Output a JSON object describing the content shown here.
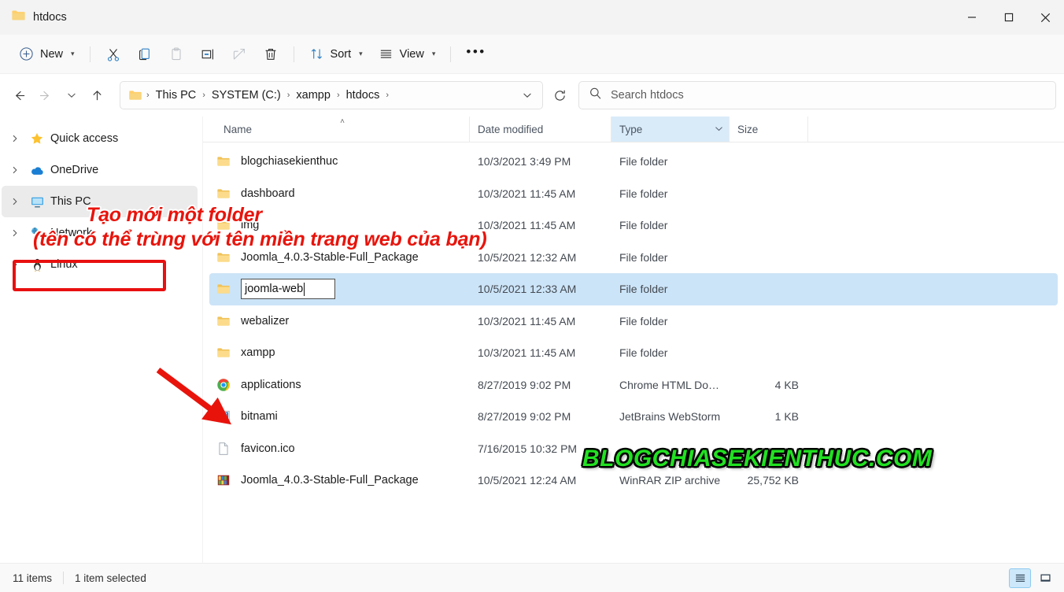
{
  "window": {
    "title": "htdocs",
    "minimize_label": "—",
    "maximize_label": "□",
    "close_label": "✕"
  },
  "toolbar": {
    "new_label": "New",
    "cut_label": "Cut",
    "copy_label": "Copy",
    "paste_label": "Paste",
    "rename_label": "Rename",
    "share_label": "Share",
    "delete_label": "Delete",
    "sort_label": "Sort",
    "view_label": "View",
    "more_label": "•••"
  },
  "address": {
    "back_label": "←",
    "forward_label": "→",
    "recent_label": "∨",
    "up_label": "↑",
    "crumbs": [
      "This PC",
      "SYSTEM (C:)",
      "xampp",
      "htdocs"
    ],
    "separator": "›",
    "dropdown_label": "∨",
    "refresh_label": "↻"
  },
  "search": {
    "placeholder": "Search htdocs"
  },
  "sidebar": {
    "items": [
      {
        "label": "Quick access",
        "icon": "star-icon",
        "expander": "›",
        "selected": false
      },
      {
        "label": "OneDrive",
        "icon": "cloud-icon",
        "expander": "›",
        "selected": false
      },
      {
        "label": "This PC",
        "icon": "monitor-icon",
        "expander": "›",
        "selected": true
      },
      {
        "label": "Network",
        "icon": "network-icon",
        "expander": "›",
        "selected": false
      },
      {
        "label": "Linux",
        "icon": "penguin-icon",
        "expander": "›",
        "selected": false
      }
    ]
  },
  "columns": {
    "name": "Name",
    "date_modified": "Date modified",
    "type": "Type",
    "size": "Size",
    "sort_indicator": "˄",
    "active_column": "Type"
  },
  "files": [
    {
      "name": "blogchiasekienthuc",
      "date": "10/3/2021 3:49 PM",
      "type": "File folder",
      "size": "",
      "icon": "folder-icon"
    },
    {
      "name": "dashboard",
      "date": "10/3/2021 11:45 AM",
      "type": "File folder",
      "size": "",
      "icon": "folder-icon"
    },
    {
      "name": "img",
      "date": "10/3/2021 11:45 AM",
      "type": "File folder",
      "size": "",
      "icon": "folder-icon"
    },
    {
      "name": "Joomla_4.0.3-Stable-Full_Package",
      "date": "10/5/2021 12:32 AM",
      "type": "File folder",
      "size": "",
      "icon": "folder-icon"
    },
    {
      "name": "joomla-web",
      "date": "10/5/2021 12:33 AM",
      "type": "File folder",
      "size": "",
      "icon": "folder-icon",
      "renaming": true,
      "selected": true
    },
    {
      "name": "webalizer",
      "date": "10/3/2021 11:45 AM",
      "type": "File folder",
      "size": "",
      "icon": "folder-icon"
    },
    {
      "name": "xampp",
      "date": "10/3/2021 11:45 AM",
      "type": "File folder",
      "size": "",
      "icon": "folder-icon"
    },
    {
      "name": "applications",
      "date": "8/27/2019 9:02 PM",
      "type": "Chrome HTML Do…",
      "size": "4 KB",
      "icon": "chrome-icon"
    },
    {
      "name": "bitnami",
      "date": "8/27/2019 9:02 PM",
      "type": "JetBrains WebStorm",
      "size": "1 KB",
      "icon": "webstorm-icon"
    },
    {
      "name": "favicon.ico",
      "date": "7/16/2015 10:32 PM",
      "type": "",
      "size": "",
      "icon": "file-icon"
    },
    {
      "name": "Joomla_4.0.3-Stable-Full_Package",
      "date": "10/5/2021 12:24 AM",
      "type": "WinRAR ZIP archive",
      "size": "25,752 KB",
      "icon": "winrar-icon"
    }
  ],
  "rename_editor": {
    "value": "joomla-web"
  },
  "statusbar": {
    "item_count": "11 items",
    "selection": "1 item selected",
    "details_view_label": "Details view",
    "large_icons_label": "Large icons view"
  },
  "annotations": {
    "line1": "Tạo mới một folder",
    "line2": "(tên có thể trùng với tên miền trang web của bạn)",
    "watermark": "BLOGCHIASEKIENTHUC.COM",
    "arrow_color": "#e8140c",
    "text_color": "#e8140c",
    "watermark_color": "#22e022",
    "highlight_color": "#e81010"
  }
}
